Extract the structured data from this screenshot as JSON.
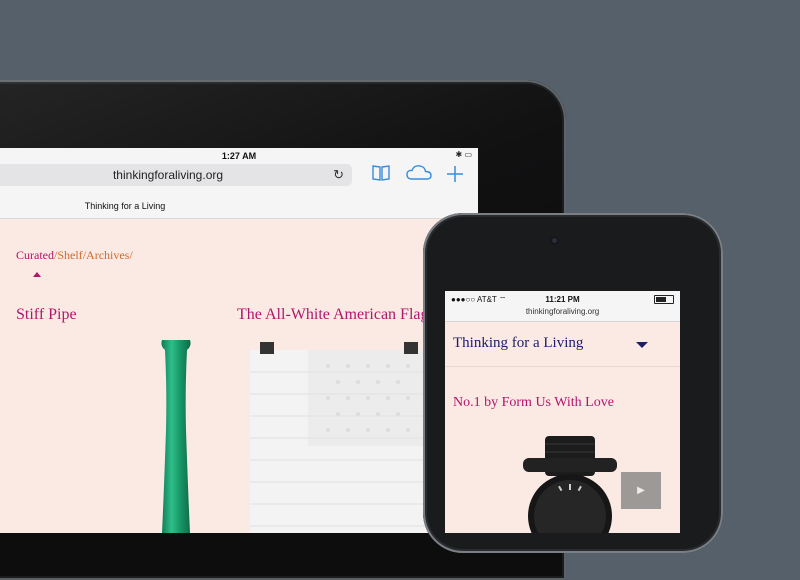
{
  "ipad": {
    "status_time": "1:27 AM",
    "url": "thinkingforaliving.org",
    "page_title": "Thinking for a Living",
    "nav": {
      "curated": "Curated",
      "shelf": "Shelf",
      "archives": "Archives",
      "separator": "/"
    },
    "items": [
      {
        "title": "Stiff Pipe"
      },
      {
        "title": "The All-White American Flag"
      }
    ]
  },
  "iphone": {
    "carrier": "AT&T",
    "status_time": "11:21 PM",
    "url": "thinkingforaliving.org",
    "site_title": "Thinking for a Living",
    "item_title": "No.1 by Form Us With Love",
    "play_label": "▶"
  },
  "colors": {
    "background": "#56606b",
    "page_bg": "#fbe9e4",
    "magenta": "#b0166c",
    "orange": "#d26a2e",
    "navy": "#1d1d6a",
    "safari_blue": "#3a8bd9"
  }
}
